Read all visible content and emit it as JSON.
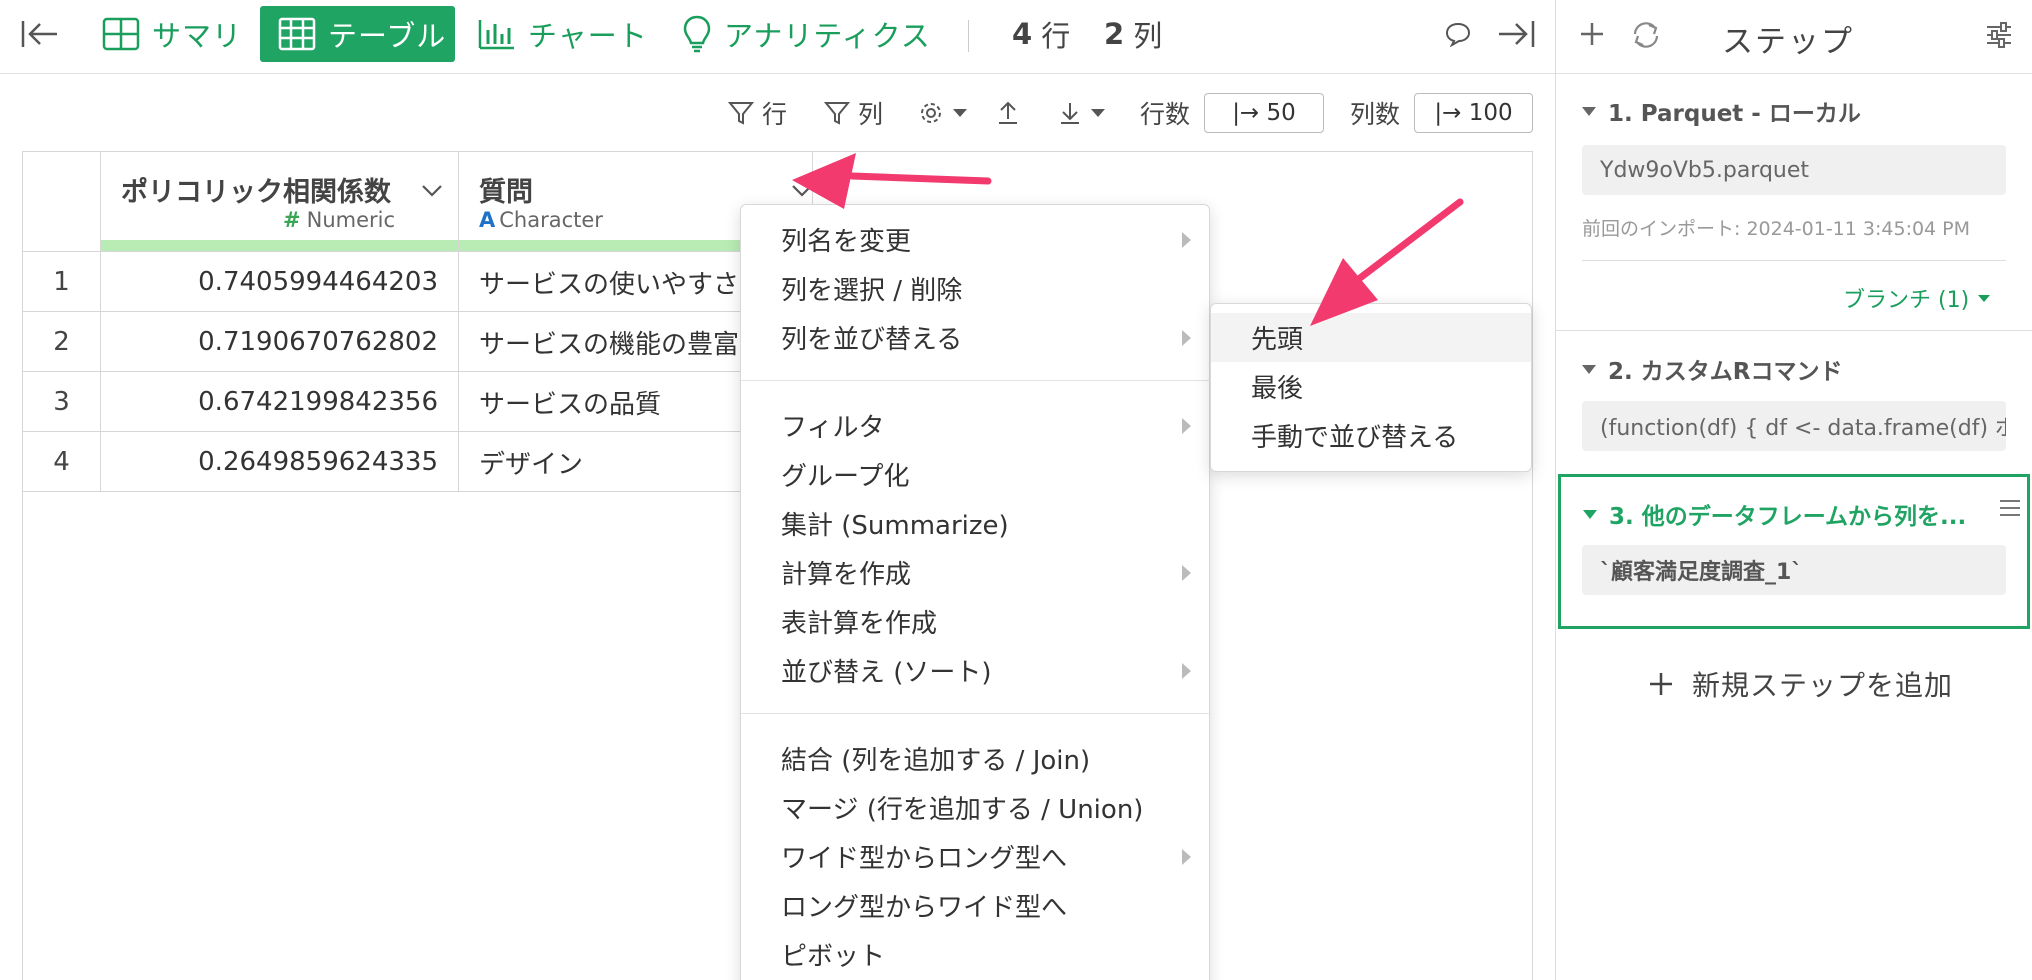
{
  "topbar": {
    "tabs": [
      {
        "label": "サマリ"
      },
      {
        "label": "テーブル"
      },
      {
        "label": "チャート"
      },
      {
        "label": "アナリティクス"
      }
    ],
    "rows_num": "4",
    "rows_unit": "行",
    "cols_num": "2",
    "cols_unit": "列"
  },
  "toolbar": {
    "filter_row": "行",
    "filter_col": "列",
    "rows_label": "行数",
    "rows_value": "|→ 50",
    "cols_label": "列数",
    "cols_value": "|→ 100"
  },
  "table": {
    "columns": [
      {
        "name": "ポリコリック相関係数",
        "type_icon": "#",
        "type": "Numeric"
      },
      {
        "name": "質問",
        "type_icon": "A",
        "type": "Character"
      }
    ],
    "rows": [
      {
        "idx": "1",
        "num": "0.7405994464203",
        "txt": "サービスの使いやすさ"
      },
      {
        "idx": "2",
        "num": "0.7190670762802",
        "txt": "サービスの機能の豊富さ"
      },
      {
        "idx": "3",
        "num": "0.6742199842356",
        "txt": "サービスの品質"
      },
      {
        "idx": "4",
        "num": "0.2649859624335",
        "txt": "デザイン"
      }
    ]
  },
  "context_menu": {
    "items": [
      "列名を変更",
      "列を選択 / 削除",
      "列を並び替える",
      "フィルタ",
      "グループ化",
      "集計 (Summarize)",
      "計算を作成",
      "表計算を作成",
      "並び替え (ソート)",
      "結合 (列を追加する / Join)",
      "マージ (行を追加する / Union)",
      "ワイド型からロング型へ",
      "ロング型からワイド型へ",
      "ピボット"
    ]
  },
  "submenu": {
    "items": [
      "先頭",
      "最後",
      "手動で並び替える"
    ]
  },
  "panel": {
    "title": "ステップ",
    "steps": [
      {
        "title": "1. Parquet - ローカル",
        "value": "Ydw9oVb5.parquet"
      },
      {
        "title": "2. カスタムRコマンド",
        "value": "(function(df) { df <- data.frame(df) ポ..."
      },
      {
        "title": "3. 他のデータフレームから列を...",
        "value": "`顧客満足度調査_1`"
      }
    ],
    "import_info": "前回のインポート: 2024-01-11 3:45:04 PM",
    "branch_label": "ブランチ (1)",
    "add_step": "新規ステップを追加"
  },
  "colors": {
    "accent": "#1fa463",
    "annotation_arrow": "#f23a6e",
    "column_bar": "#b9ecb4"
  }
}
